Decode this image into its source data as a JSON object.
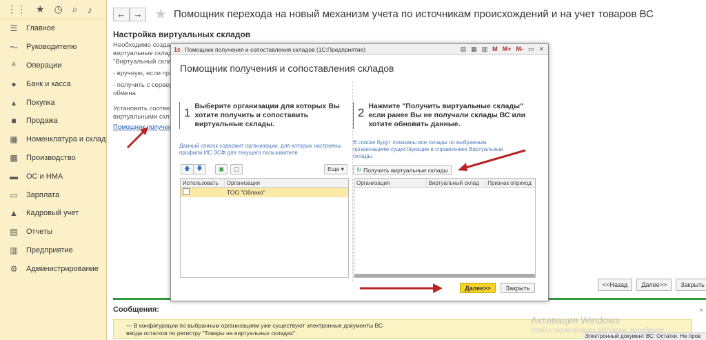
{
  "sidebar": {
    "items": [
      {
        "label": "Главное",
        "icon": "menu-icon"
      },
      {
        "label": "Руководителю",
        "icon": "chart-line-icon"
      },
      {
        "label": "Операции",
        "icon": "operations-icon"
      },
      {
        "label": "Банк и касса",
        "icon": "bank-icon"
      },
      {
        "label": "Покупка",
        "icon": "cart-icon"
      },
      {
        "label": "Продажа",
        "icon": "bag-icon"
      },
      {
        "label": "Номенклатура и склад",
        "icon": "grid-icon"
      },
      {
        "label": "Производство",
        "icon": "factory-icon"
      },
      {
        "label": "ОС и НМА",
        "icon": "truck-icon"
      },
      {
        "label": "Зарплата",
        "icon": "money-icon"
      },
      {
        "label": "Кадровый учет",
        "icon": "person-icon"
      },
      {
        "label": "Отчеты",
        "icon": "reports-icon"
      },
      {
        "label": "Предприятие",
        "icon": "building-icon"
      },
      {
        "label": "Администрирование",
        "icon": "gear-icon"
      }
    ]
  },
  "header": {
    "title": "Помощник перехода на новый механизм учета по источникам происхождений и на учет товаров ВС"
  },
  "main": {
    "section_title": "Настройка виртуальных складов",
    "lines": [
      "Необходимо созда",
      "виртуальные склад",
      "\"Виртуальный скла",
      "- вручную, если пря",
      "- получить с сервер",
      "обмена",
      "Установить соотве",
      "виртуальными скл"
    ],
    "link": "Помощник получения",
    "buttons": {
      "back": "<<Назад",
      "next": "Далее>>",
      "close": "Закрыть"
    }
  },
  "messages": {
    "title": "Сообщения:",
    "text1": "— В конфигурации по выбранным организациям уже существуют электронные документы ВС",
    "text2": "ввода остатков по регистру \"Товары на виртуальных складах\"."
  },
  "watermark": {
    "line1": "Активация Windows",
    "line2": "Чтобы активировать Windows, перейдите"
  },
  "status_bar": "Электронный документ ВС: Остатки. Не пров",
  "dialog": {
    "window_title": "Помощник получения и сопоставления складов  (1С:Предприятие)",
    "heading": "Помощник получения и сопоставления складов",
    "step1": {
      "num": "1",
      "text": "Выберите организации для которых Вы хотите получить и сопоставить виртуальные склады."
    },
    "step2": {
      "num": "2",
      "text": "Нажмите \"Получить виртуальные склады\" если ранее Вы не получали склады ВС или хотите обновить данные."
    },
    "hint1": "Данный список содержит организации, для которых настроены профили ИС ЭСФ для текущего пользователя",
    "hint2": "В списке будут показаны все склады по выбранным организациям существующие в справочнике Виртуальные склады.",
    "more_label": "Еще ▾",
    "get_button": "Получить виртуальные склады",
    "table1": {
      "columns": [
        "Использовать",
        "Организация"
      ],
      "rows": [
        {
          "use": false,
          "org": "ТОО \"Облако\""
        }
      ]
    },
    "table2": {
      "columns": [
        "Организация",
        "Виртуальный склад",
        "Признак оприход"
      ]
    },
    "next_button": "Далее>>",
    "close_button": "Закрыть"
  }
}
